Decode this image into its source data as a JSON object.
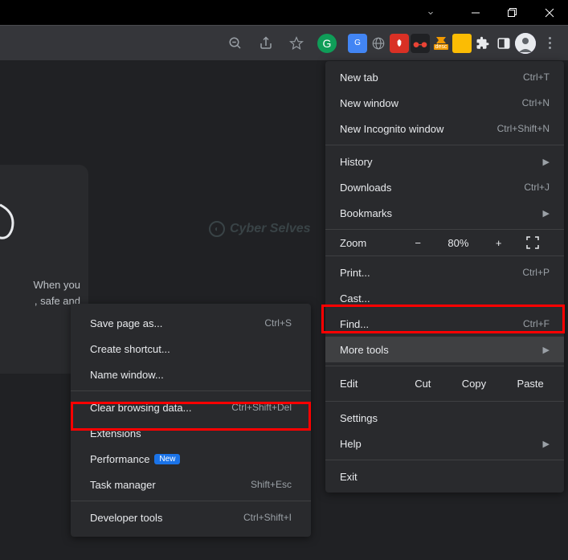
{
  "titlebar": {
    "minimize": "−",
    "maximize": "❐",
    "close": "✕"
  },
  "toolbar": {
    "extensions": {
      "grammarly": "G",
      "translate": "G",
      "desc": "desc"
    }
  },
  "ntp": {
    "line1": "When you",
    "line2": ", safe and"
  },
  "watermark": {
    "text": "Cyber Selves"
  },
  "menu": {
    "new_tab": {
      "label": "New tab",
      "shortcut": "Ctrl+T"
    },
    "new_window": {
      "label": "New window",
      "shortcut": "Ctrl+N"
    },
    "new_incognito": {
      "label": "New Incognito window",
      "shortcut": "Ctrl+Shift+N"
    },
    "history": {
      "label": "History"
    },
    "downloads": {
      "label": "Downloads",
      "shortcut": "Ctrl+J"
    },
    "bookmarks": {
      "label": "Bookmarks"
    },
    "zoom": {
      "label": "Zoom",
      "minus": "−",
      "value": "80%",
      "plus": "+"
    },
    "print": {
      "label": "Print...",
      "shortcut": "Ctrl+P"
    },
    "cast": {
      "label": "Cast..."
    },
    "find": {
      "label": "Find...",
      "shortcut": "Ctrl+F"
    },
    "more_tools": {
      "label": "More tools"
    },
    "edit": {
      "label": "Edit",
      "cut": "Cut",
      "copy": "Copy",
      "paste": "Paste"
    },
    "settings": {
      "label": "Settings"
    },
    "help": {
      "label": "Help"
    },
    "exit": {
      "label": "Exit"
    }
  },
  "submenu": {
    "save_page": {
      "label": "Save page as...",
      "shortcut": "Ctrl+S"
    },
    "create_shortcut": {
      "label": "Create shortcut..."
    },
    "name_window": {
      "label": "Name window..."
    },
    "clear_data": {
      "label": "Clear browsing data...",
      "shortcut": "Ctrl+Shift+Del"
    },
    "extensions": {
      "label": "Extensions"
    },
    "performance": {
      "label": "Performance",
      "badge": "New"
    },
    "task_manager": {
      "label": "Task manager",
      "shortcut": "Shift+Esc"
    },
    "dev_tools": {
      "label": "Developer tools",
      "shortcut": "Ctrl+Shift+I"
    }
  }
}
